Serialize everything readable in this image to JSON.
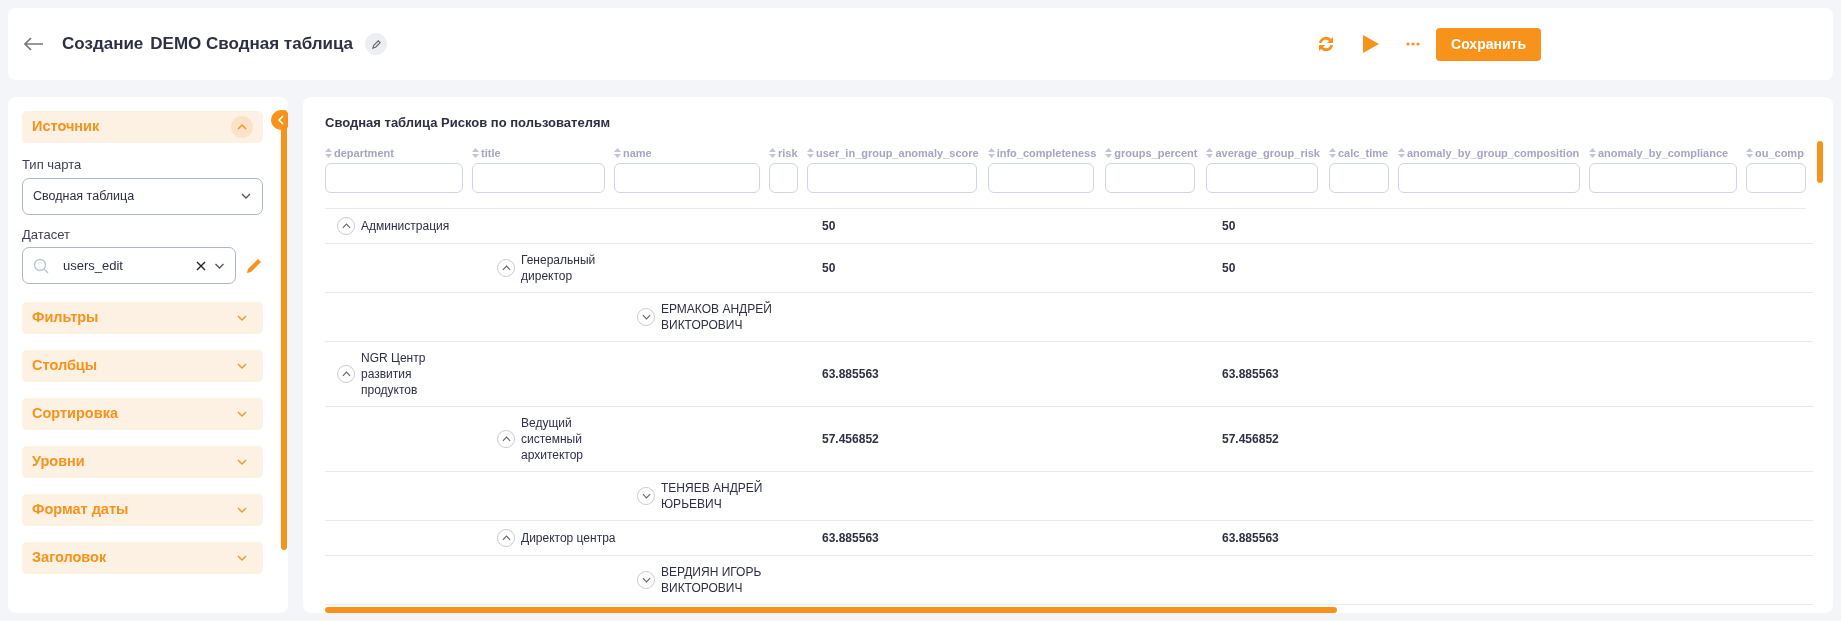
{
  "header": {
    "title_prefix": "Создание",
    "title": "DEMO Сводная таблица",
    "save_button": "Сохранить"
  },
  "sidebar": {
    "sections": [
      {
        "label": "Источник",
        "expanded": true,
        "fields": [
          {
            "kind": "select",
            "label": "Тип чарта",
            "value": "Сводная таблица"
          },
          {
            "kind": "search",
            "label": "Датасет",
            "value": "users_edit"
          }
        ]
      },
      {
        "label": "Фильтры",
        "expanded": false
      },
      {
        "label": "Столбцы",
        "expanded": false
      },
      {
        "label": "Сортировка",
        "expanded": false
      },
      {
        "label": "Уровни",
        "expanded": false
      },
      {
        "label": "Формат даты",
        "expanded": false
      },
      {
        "label": "Заголовок",
        "expanded": false
      }
    ]
  },
  "report": {
    "title": "Сводная таблица Рисков по пользователям",
    "columns": [
      "department",
      "title",
      "name",
      "risk",
      "user_in_group_anomaly_score",
      "info_completeness",
      "groups_percent",
      "average_group_risk",
      "calc_time",
      "anomaly_by_group_composition",
      "anomaly_by_compliance",
      "ou_comp"
    ],
    "rows": [
      {
        "label": "Администрация",
        "expanded": true,
        "user_in_group_anomaly_score": "50",
        "average_group_risk": "50",
        "children": [
          {
            "label": "Генеральный директор",
            "expanded": true,
            "user_in_group_anomaly_score": "50",
            "average_group_risk": "50",
            "children": [
              {
                "label": "ЕРМАКОВ АНДРЕЙ ВИКТОРОВИЧ",
                "expanded": false
              }
            ]
          }
        ]
      },
      {
        "label": "NGR Центр развития продуктов",
        "expanded": true,
        "user_in_group_anomaly_score": "63.885563",
        "average_group_risk": "63.885563",
        "children": [
          {
            "label": "Ведущий системный архитектор",
            "expanded": true,
            "user_in_group_anomaly_score": "57.456852",
            "average_group_risk": "57.456852",
            "children": [
              {
                "label": "ТЕНЯЕВ АНДРЕЙ ЮРЬЕВИЧ",
                "expanded": false
              }
            ]
          },
          {
            "label": "Директор центра",
            "expanded": true,
            "user_in_group_anomaly_score": "63.885563",
            "average_group_risk": "63.885563",
            "children": [
              {
                "label": "ВЕРДИЯН ИГОРЬ ВИКТОРОВИЧ",
                "expanded": false
              }
            ]
          }
        ]
      }
    ]
  }
}
